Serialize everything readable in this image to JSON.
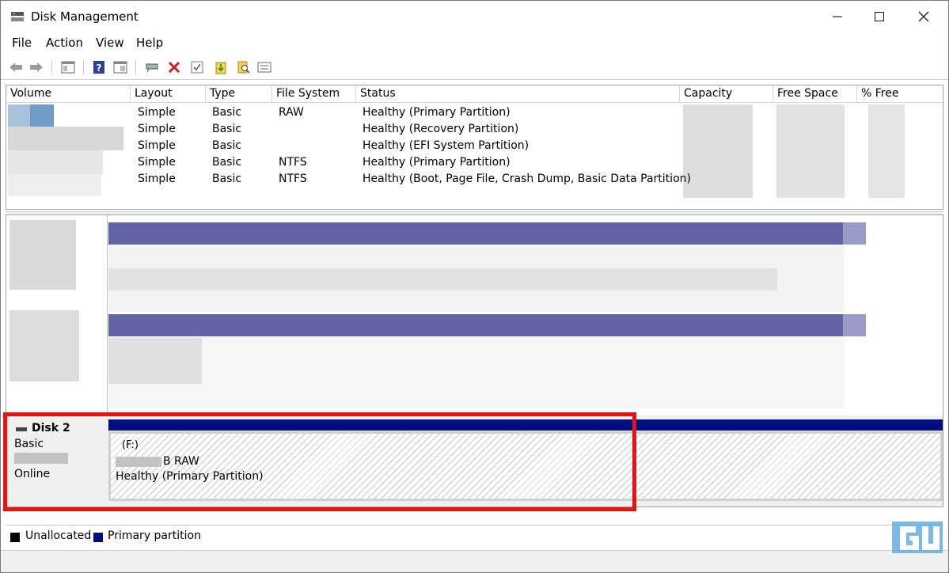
{
  "window": {
    "title": "Disk Management"
  },
  "menu": [
    "File",
    "Action",
    "View",
    "Help"
  ],
  "toolbar": {
    "icons": [
      "back-arrow-icon",
      "forward-arrow-icon",
      "console-tree-icon",
      "help-icon",
      "properties-icon",
      "connect-icon",
      "delete-icon",
      "check-icon",
      "import-icon",
      "search-icon",
      "settings-panel-icon"
    ]
  },
  "volume_table": {
    "columns": [
      "Volume",
      "Layout",
      "Type",
      "File System",
      "Status",
      "Capacity",
      "Free Space",
      "% Free"
    ],
    "rows": [
      {
        "layout": "Simple",
        "type": "Basic",
        "fs": "RAW",
        "status": "Healthy (Primary Partition)"
      },
      {
        "layout": "Simple",
        "type": "Basic",
        "fs": "",
        "status": "Healthy (Recovery Partition)"
      },
      {
        "layout": "Simple",
        "type": "Basic",
        "fs": "",
        "status": "Healthy (EFI System Partition)"
      },
      {
        "layout": "Simple",
        "type": "Basic",
        "fs": "NTFS",
        "status": "Healthy (Primary Partition)"
      },
      {
        "layout": "Simple",
        "type": "Basic",
        "fs": "NTFS",
        "status": "Healthy (Boot, Page File, Crash Dump, Basic Data Partition)"
      }
    ]
  },
  "disk2": {
    "name": "Disk 2",
    "type": "Basic",
    "status": "Online",
    "partition": {
      "drive": "(F:)",
      "size_suffix": "B RAW",
      "status": "Healthy (Primary Partition)"
    }
  },
  "legend": [
    {
      "label": "Unallocated",
      "color": "#000000"
    },
    {
      "label": "Primary partition",
      "color": "#000f80"
    }
  ],
  "colors": {
    "highlight": "#ee1010",
    "primary_partition": "#000f80",
    "partition_bar": "#6264a7"
  }
}
